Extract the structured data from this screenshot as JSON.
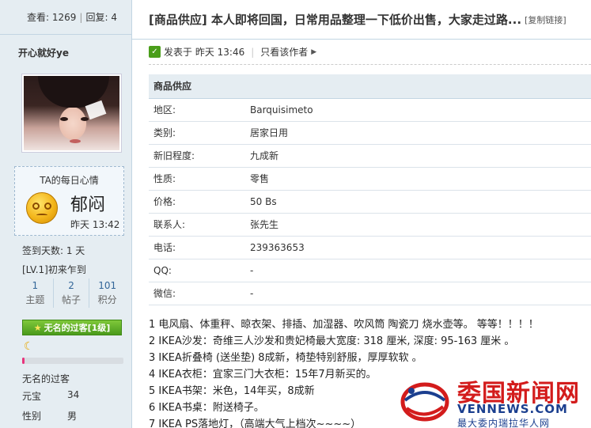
{
  "sidebar": {
    "views_label": "查看:",
    "views": "1269",
    "replies_label": "回复:",
    "replies": "4",
    "author": "开心就好ye",
    "mood_title": "TA的每日心情",
    "mood_word": "郁闷",
    "mood_time": "昨天 13:42",
    "checkin": "签到天数: 1 天",
    "level": "[LV.1]初来乍到",
    "counts": [
      {
        "num": "1",
        "label": "主题"
      },
      {
        "num": "2",
        "label": "帖子"
      },
      {
        "num": "101",
        "label": "积分"
      }
    ],
    "badge": "无名的过客[1级]",
    "progress_fraction": 0.02,
    "rank": "无名的过客",
    "coins_label": "元宝",
    "coins": "34",
    "gender_label": "性别",
    "gender": "男"
  },
  "post": {
    "title": "[商品供应] 本人即将回国，日常用品整理一下低价出售，大家走过路...",
    "copy_link": "[复制链接]",
    "posted": "发表于 昨天 13:46",
    "only_author": "只看该作者"
  },
  "table": {
    "header": "商品供应",
    "rows": [
      {
        "k": "地区:",
        "v": "Barquisimeto"
      },
      {
        "k": "类别:",
        "v": "居家日用"
      },
      {
        "k": "新旧程度:",
        "v": "九成新"
      },
      {
        "k": "性质:",
        "v": "零售"
      },
      {
        "k": "价格:",
        "v": "50 Bs"
      },
      {
        "k": "联系人:",
        "v": "张先生"
      },
      {
        "k": "电话:",
        "v": "239363653"
      },
      {
        "k": "QQ:",
        "v": "-"
      },
      {
        "k": "微信:",
        "v": "-"
      }
    ]
  },
  "description": [
    "1 电风扇、体重秤、晾衣架、排插、加湿器、吹风筒 陶瓷刀 烧水壶等。 等等！！！！",
    "2 IKEA沙发：奇维三人沙发和贵妃椅最大宽度: 318 厘米, 深度: 95-163 厘米 。",
    "3 IKEA折叠椅 (送坐垫) 8成新，椅垫特别舒服，厚厚软软 。",
    "4 IKEA衣柜：宜家三门大衣柜：15年7月新买的。",
    "5 IKEA书架：米色，14年买，8成新",
    "6 IKEA书桌：附送椅子。",
    "7 IKEA PS落地灯，（高端大气上档次~~~~）"
  ],
  "watermark": {
    "line1": "委国新闻网",
    "line2": "VENNEWS.COM",
    "line3": "最大委内瑞拉华人网"
  }
}
